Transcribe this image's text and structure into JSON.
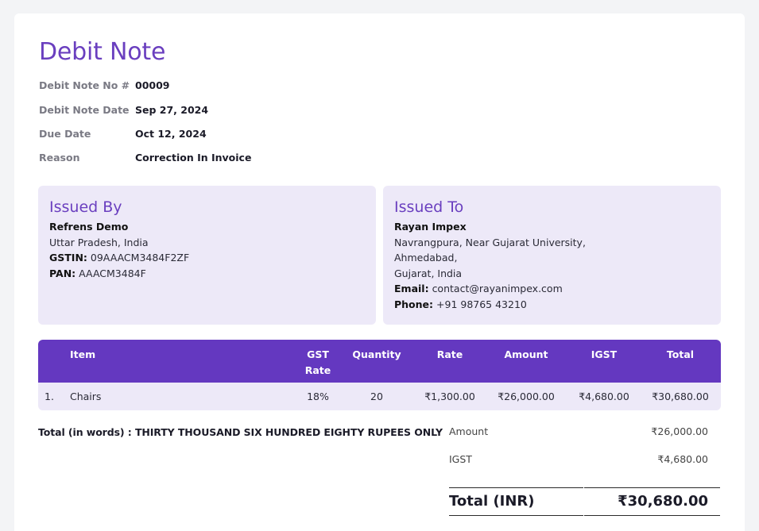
{
  "document": {
    "title": "Debit Note",
    "meta": [
      {
        "label": "Debit Note No #",
        "value": "00009"
      },
      {
        "label": "Debit Note Date",
        "value": "Sep 27, 2024"
      },
      {
        "label": "Due Date",
        "value": "Oct 12, 2024"
      },
      {
        "label": "Reason",
        "value": "Correction In Invoice"
      }
    ]
  },
  "issued_by": {
    "heading": "Issued By",
    "name": "Refrens Demo",
    "address": "Uttar Pradesh, India",
    "gstin_label": "GSTIN:",
    "gstin": "09AAACM3484F2ZF",
    "pan_label": "PAN:",
    "pan": "AAACM3484F"
  },
  "issued_to": {
    "heading": "Issued To",
    "name": "Rayan Impex",
    "address_line1": "Navrangpura, Near Gujarat University,",
    "address_line2": "Ahmedabad,",
    "address_line3": "Gujarat, India",
    "email_label": "Email:",
    "email": "contact@rayanimpex.com",
    "phone_label": "Phone:",
    "phone": "+91 98765 43210"
  },
  "table": {
    "headers": {
      "item": "Item",
      "gst_rate_1": "GST",
      "gst_rate_2": "Rate",
      "quantity": "Quantity",
      "rate": "Rate",
      "amount": "Amount",
      "igst": "IGST",
      "total": "Total"
    },
    "rows": [
      {
        "index": "1.",
        "item": "Chairs",
        "gst_rate": "18%",
        "quantity": "20",
        "rate": "₹1,300.00",
        "amount": "₹26,000.00",
        "igst": "₹4,680.00",
        "total": "₹30,680.00"
      }
    ]
  },
  "totals": {
    "in_words": "Total (in words) : THIRTY THOUSAND SIX HUNDRED EIGHTY RUPEES ONLY",
    "amount_label": "Amount",
    "amount": "₹26,000.00",
    "igst_label": "IGST",
    "igst": "₹4,680.00",
    "total_label": "Total (INR)",
    "total": "₹30,680.00"
  }
}
